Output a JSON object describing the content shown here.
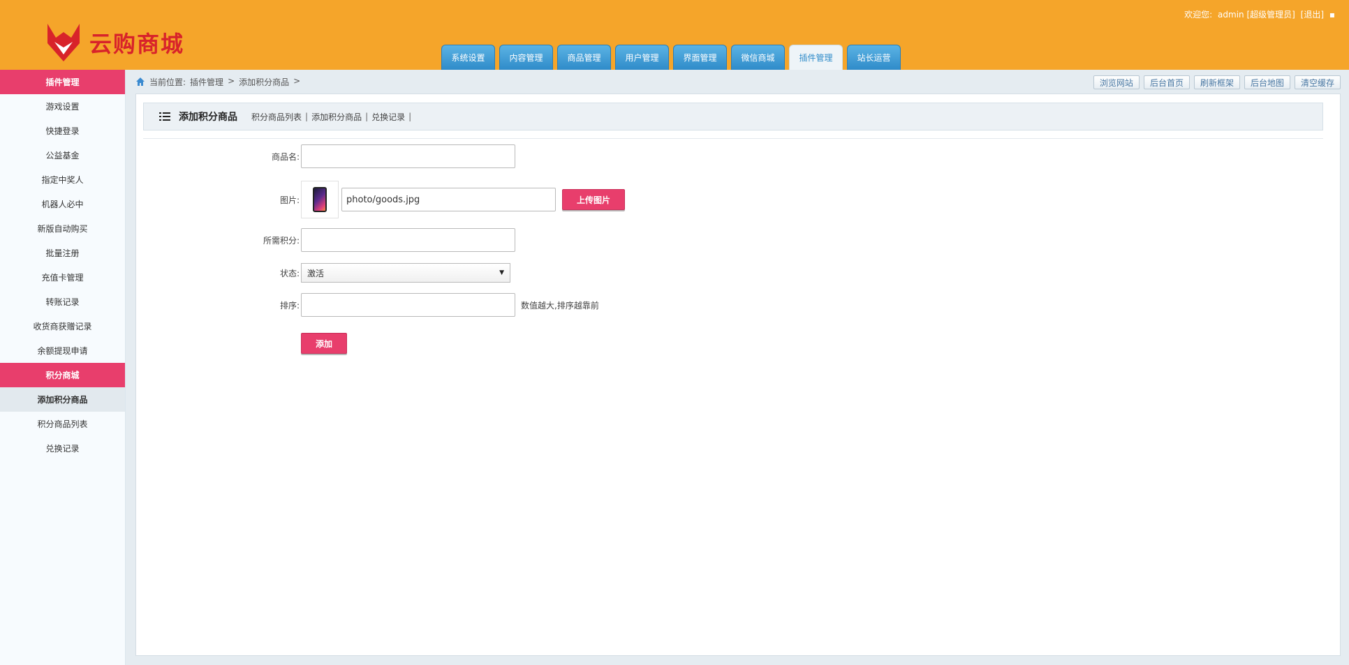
{
  "header": {
    "logo_text": "云购商城",
    "welcome_label": "欢迎您:",
    "user": "admin [超级管理员]",
    "logout": "[退出]"
  },
  "nav": {
    "tabs": [
      {
        "label": "系统设置"
      },
      {
        "label": "内容管理"
      },
      {
        "label": "商品管理"
      },
      {
        "label": "用户管理"
      },
      {
        "label": "界面管理"
      },
      {
        "label": "微信商城"
      },
      {
        "label": "插件管理"
      },
      {
        "label": "站长运营"
      }
    ],
    "active": "插件管理"
  },
  "sidebar": {
    "section1": "插件管理",
    "items1": [
      "游戏设置",
      "快捷登录",
      "公益基金",
      "指定中奖人",
      "机器人必中",
      "新版自动购买",
      "批量注册",
      "充值卡管理",
      "转账记录",
      "收货商获赠记录",
      "余额提现申请"
    ],
    "section2": "积分商城",
    "items2": [
      "添加积分商品",
      "积分商品列表",
      "兑换记录"
    ]
  },
  "breadcrumb": {
    "prefix": "当前位置:",
    "items": [
      "插件管理",
      ">",
      "添加积分商品",
      ">"
    ]
  },
  "top_buttons": [
    "浏览网站",
    "后台首页",
    "刷新框架",
    "后台地图",
    "清空缓存"
  ],
  "page": {
    "title": "添加积分商品",
    "links": [
      "积分商品列表",
      "添加积分商品",
      "兑换记录"
    ]
  },
  "form": {
    "name_label": "商品名:",
    "name_value": "",
    "image_label": "图片:",
    "image_path": "photo/goods.jpg",
    "upload_button": "上传图片",
    "points_label": "所需积分:",
    "points_value": "",
    "status_label": "状态:",
    "status_value": "激活",
    "sort_label": "排序:",
    "sort_value": "",
    "sort_hint": "数值越大,排序越靠前",
    "submit_button": "添加"
  }
}
